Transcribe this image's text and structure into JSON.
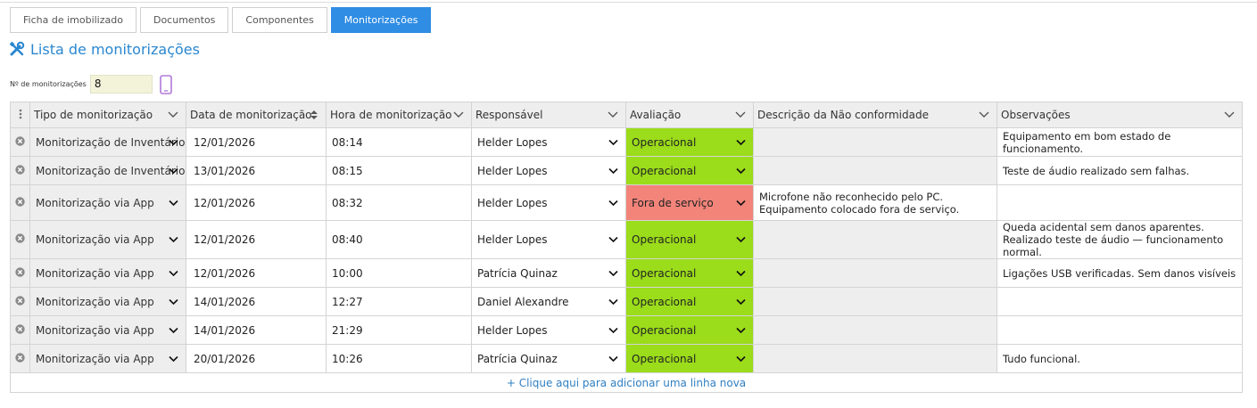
{
  "tabs": [
    {
      "label": "Ficha de imobilizado",
      "active": false
    },
    {
      "label": "Documentos",
      "active": false
    },
    {
      "label": "Componentes",
      "active": false
    },
    {
      "label": "Monitorizações",
      "active": true
    }
  ],
  "section": {
    "title": "Lista de monitorizações",
    "icon": "tools-icon"
  },
  "count": {
    "label": "Nº de monitorizações",
    "value": "8",
    "icon": "phone-icon"
  },
  "grid": {
    "columns": [
      "Tipo de monitorização",
      "Data de monitorização",
      "Hora de monitorização",
      "Responsável",
      "Avaliação",
      "Descrição da Não conformidade",
      "Observações"
    ],
    "rows": [
      {
        "tipo": "Monitorização de Inventário",
        "data": "12/01/2026",
        "hora": "08:14",
        "responsavel": "Helder Lopes",
        "avaliacao": "Operacional",
        "descricao": "",
        "observacoes": "Equipamento em bom estado de funcionamento."
      },
      {
        "tipo": "Monitorização de Inventário",
        "data": "13/01/2026",
        "hora": "08:15",
        "responsavel": "Helder Lopes",
        "avaliacao": "Operacional",
        "descricao": "",
        "observacoes": "Teste de áudio realizado sem falhas."
      },
      {
        "tipo": "Monitorização via App",
        "data": "12/01/2026",
        "hora": "08:32",
        "responsavel": "Helder Lopes",
        "avaliacao": "Fora de serviço",
        "descricao": "Microfone não reconhecido pelo PC. Equipamento colocado fora de serviço.",
        "observacoes": ""
      },
      {
        "tipo": "Monitorização via App",
        "data": "12/01/2026",
        "hora": "08:40",
        "responsavel": "Helder Lopes",
        "avaliacao": "Operacional",
        "descricao": "",
        "observacoes": "Queda acidental sem danos aparentes. Realizado teste de áudio — funcionamento normal."
      },
      {
        "tipo": "Monitorização via App",
        "data": "12/01/2026",
        "hora": "10:00",
        "responsavel": "Patrícia Quinaz",
        "avaliacao": "Operacional",
        "descricao": "",
        "observacoes": "Ligações USB verificadas. Sem danos visíveis"
      },
      {
        "tipo": "Monitorização via App",
        "data": "14/01/2026",
        "hora": "12:27",
        "responsavel": "Daniel Alexandre",
        "avaliacao": "Operacional",
        "descricao": "",
        "observacoes": ""
      },
      {
        "tipo": "Monitorização via App",
        "data": "14/01/2026",
        "hora": "21:29",
        "responsavel": "Helder Lopes",
        "avaliacao": "Operacional",
        "descricao": "",
        "observacoes": ""
      },
      {
        "tipo": "Monitorização via App",
        "data": "20/01/2026",
        "hora": "10:26",
        "responsavel": "Patrícia Quinaz",
        "avaliacao": "Operacional",
        "descricao": "",
        "observacoes": "Tudo funcional."
      }
    ],
    "add_row_label": "+ Clique aqui para adicionar uma linha nova"
  },
  "colors": {
    "accent": "#2f8de4",
    "title": "#2a87d0",
    "ok": "#9bdc1b",
    "bad": "#f2847a",
    "header": "#eeeeee"
  }
}
